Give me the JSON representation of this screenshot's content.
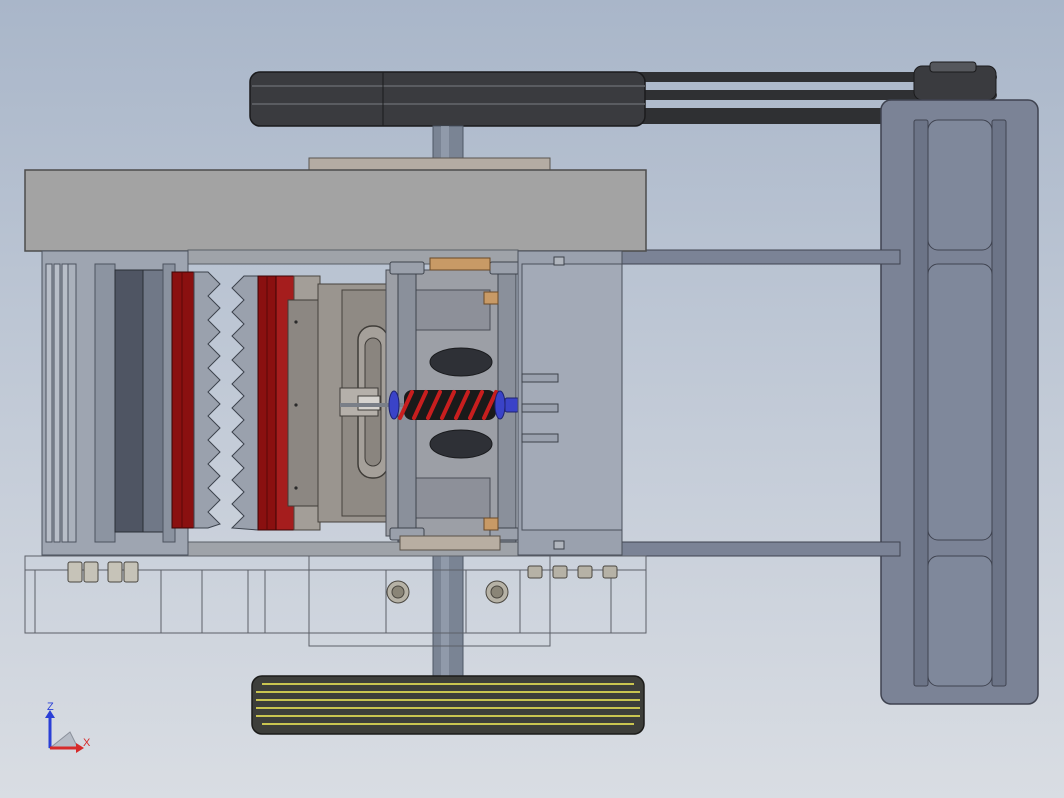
{
  "viewport": {
    "background_top": "#a9b6c9",
    "background_bottom": "#d9dde3"
  },
  "triad": {
    "z_label": "Z",
    "x_label": "X",
    "z_color": "#2a3fd6",
    "x_color": "#d62a2a"
  },
  "colors": {
    "belt": "#2f3033",
    "frame": "#9fa3a9",
    "frame_dark": "#7f858d",
    "arm": "#7b8396",
    "jaw_red": "#8a1010",
    "spring": "#c81e1e",
    "spring_core": "#1a1a1a",
    "bolt_blue": "#3a43c8",
    "pulley_stripe": "#c9c450",
    "bronze": "#c89a66"
  }
}
